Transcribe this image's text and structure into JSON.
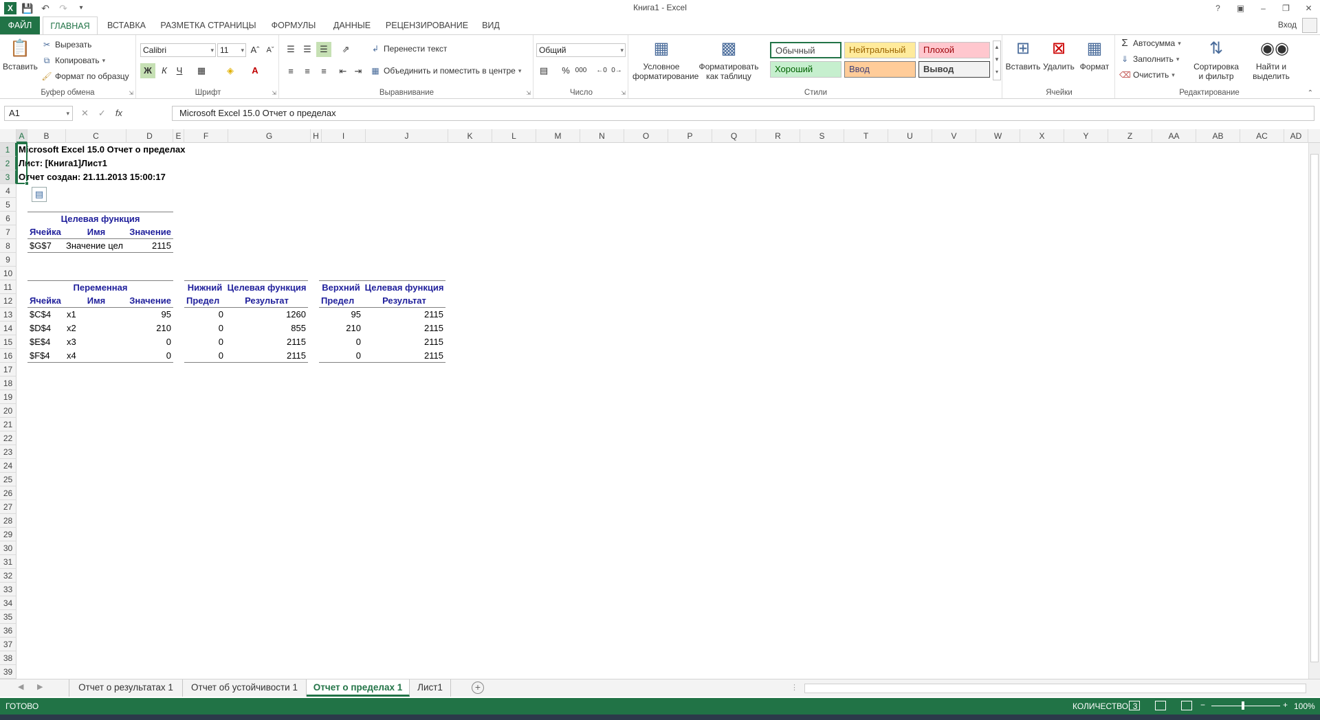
{
  "window": {
    "title": "Книга1 - Excel",
    "sign_in": "Вход",
    "help": "?",
    "min": "–",
    "restore": "❐",
    "close": "✕"
  },
  "tabs": [
    "ФАЙЛ",
    "ГЛАВНАЯ",
    "ВСТАВКА",
    "РАЗМЕТКА СТРАНИЦЫ",
    "ФОРМУЛЫ",
    "ДАННЫЕ",
    "РЕЦЕНЗИРОВАНИЕ",
    "ВИД"
  ],
  "ribbon": {
    "clipboard": {
      "label": "Буфер обмена",
      "paste": "Вставить",
      "cut": "Вырезать",
      "copy": "Копировать",
      "format_painter": "Формат по образцу"
    },
    "font": {
      "label": "Шрифт",
      "name": "Calibri",
      "size": "11",
      "bold": "Ж",
      "italic": "К",
      "underline": "Ч"
    },
    "alignment": {
      "label": "Выравнивание",
      "wrap": "Перенести текст",
      "merge": "Объединить и поместить в центре"
    },
    "number": {
      "label": "Число",
      "format": "Общий",
      "percent": "%",
      "thousands": "000"
    },
    "styles": {
      "label": "Стили",
      "conditional": [
        "Условное",
        "форматирование"
      ],
      "as_table": [
        "Форматировать",
        "как таблицу"
      ],
      "boxes": [
        "Обычный",
        "Нейтральный",
        "Плохой",
        "Хороший",
        "Ввод",
        "Вывод"
      ]
    },
    "cells": {
      "label": "Ячейки",
      "insert": "Вставить",
      "delete": "Удалить",
      "format": "Формат"
    },
    "editing": {
      "label": "Редактирование",
      "autosum": "Автосумма",
      "fill": "Заполнить",
      "clear": "Очистить",
      "sort": [
        "Сортировка",
        "и фильтр"
      ],
      "find": [
        "Найти и",
        "выделить"
      ]
    },
    "colors": {
      "green": "#217346",
      "neutral": "#ffeb9c",
      "bad": "#ffc7ce",
      "good": "#c6efce",
      "input": "#ffcc99",
      "output": "#f2f2f2"
    }
  },
  "formula_bar": {
    "name_box": "A1",
    "fx": "fx",
    "content": "Microsoft Excel 15.0 Отчет о пределах"
  },
  "columns": [
    "A",
    "B",
    "C",
    "D",
    "E",
    "F",
    "G",
    "H",
    "I",
    "J",
    "K",
    "L",
    "M",
    "N",
    "O",
    "P",
    "Q",
    "R",
    "S",
    "T",
    "U",
    "V",
    "W",
    "X",
    "Y",
    "Z",
    "AA",
    "AB",
    "AC",
    "AD"
  ],
  "rows": [
    "1",
    "2",
    "3",
    "4",
    "5",
    "6",
    "7",
    "8",
    "9",
    "10",
    "11",
    "12",
    "13",
    "14",
    "15",
    "16",
    "17",
    "18",
    "19",
    "20",
    "21",
    "22",
    "23",
    "24",
    "25",
    "26",
    "27",
    "28",
    "29",
    "30",
    "31",
    "32",
    "33",
    "34",
    "35",
    "36",
    "37",
    "38",
    "39"
  ],
  "report": {
    "line1": "Microsoft Excel 15.0 Отчет о пределах",
    "line2": "Лист: [Книга1]Лист1",
    "line3": "Отчет создан: 21.11.2013 15:00:17",
    "target": {
      "title": "Целевая функция",
      "headers": [
        "Ячейка",
        "Имя",
        "Значение"
      ],
      "row": [
        "$G$7",
        "Значение цел",
        "2115"
      ]
    },
    "variables": {
      "title": "Переменная",
      "headers": [
        "Ячейка",
        "Имя",
        "Значение"
      ],
      "lower_title": [
        "Нижний",
        "Целевая функция"
      ],
      "lower_headers": [
        "Предел",
        "Результат"
      ],
      "upper_title": [
        "Верхний",
        "Целевая функция"
      ],
      "upper_headers": [
        "Предел",
        "Результат"
      ],
      "rows": [
        [
          "$C$4",
          "x1",
          "95",
          "0",
          "1260",
          "95",
          "2115"
        ],
        [
          "$D$4",
          "x2",
          "210",
          "0",
          "855",
          "210",
          "2115"
        ],
        [
          "$E$4",
          "x3",
          "0",
          "0",
          "2115",
          "0",
          "2115"
        ],
        [
          "$F$4",
          "x4",
          "0",
          "0",
          "2115",
          "0",
          "2115"
        ]
      ]
    }
  },
  "sheet_tabs": [
    "Отчет о результатах 1",
    "Отчет об устойчивости 1",
    "Отчет о пределах 1",
    "Лист1"
  ],
  "active_sheet_index": 2,
  "status": {
    "ready": "ГОТОВО",
    "count": "КОЛИЧЕСТВО: 3",
    "zoom": "100%"
  }
}
